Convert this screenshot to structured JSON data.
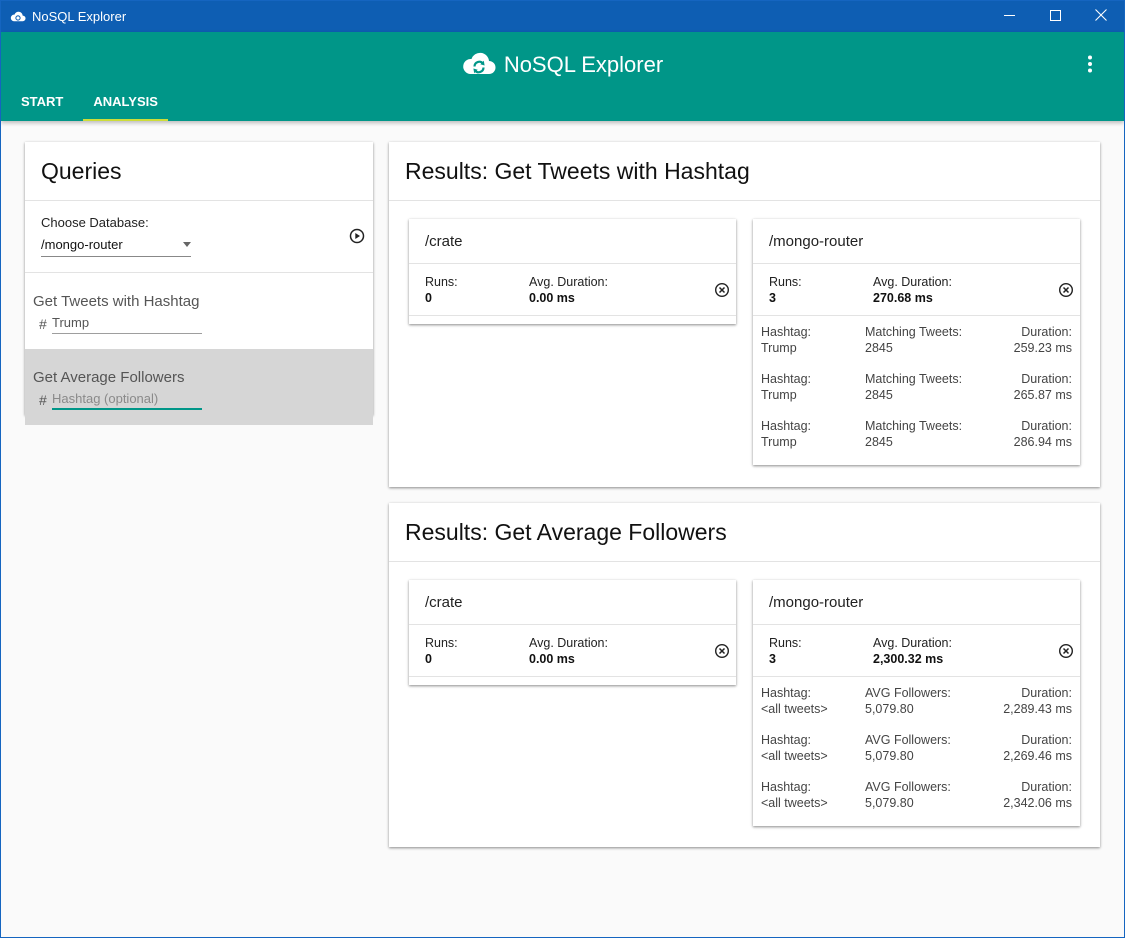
{
  "window": {
    "title": "NoSQL Explorer",
    "controls": [
      "minimize-icon",
      "maximize-icon",
      "close-icon"
    ]
  },
  "header": {
    "app_name": "NoSQL Explorer",
    "logo_icon": "cloud-sync-icon",
    "menu_icon": "more-vertical-icon",
    "accent_color": "#009688",
    "tabs": [
      {
        "label": "START",
        "active": false
      },
      {
        "label": "ANALYSIS",
        "active": true
      }
    ]
  },
  "queries": {
    "title": "Queries",
    "db_label": "Choose Database:",
    "db_value": "/mongo-router",
    "run_icon": "play-circle-icon",
    "items": [
      {
        "title": "Get Tweets with Hashtag",
        "prefix": "#",
        "value": "Trump",
        "placeholder": "",
        "selected": false
      },
      {
        "title": "Get Average Followers",
        "prefix": "#",
        "value": "",
        "placeholder": "Hashtag (optional)",
        "selected": true
      }
    ]
  },
  "results": [
    {
      "title": "Results: Get Tweets with Hashtag",
      "databases": [
        {
          "name": "/crate",
          "runs_label": "Runs:",
          "runs": "0",
          "avg_label": "Avg. Duration:",
          "avg": "0.00 ms",
          "rows": []
        },
        {
          "name": "/mongo-router",
          "runs_label": "Runs:",
          "runs": "3",
          "avg_label": "Avg. Duration:",
          "avg": "270.68 ms",
          "rows": [
            {
              "c1_label": "Hashtag:",
              "c1_value": "Trump",
              "c2_label": "Matching Tweets:",
              "c2_value": "2845",
              "c3_label": "Duration:",
              "c3_value": "259.23 ms"
            },
            {
              "c1_label": "Hashtag:",
              "c1_value": "Trump",
              "c2_label": "Matching Tweets:",
              "c2_value": "2845",
              "c3_label": "Duration:",
              "c3_value": "265.87 ms"
            },
            {
              "c1_label": "Hashtag:",
              "c1_value": "Trump",
              "c2_label": "Matching Tweets:",
              "c2_value": "2845",
              "c3_label": "Duration:",
              "c3_value": "286.94 ms"
            }
          ]
        }
      ]
    },
    {
      "title": "Results: Get Average Followers",
      "databases": [
        {
          "name": "/crate",
          "runs_label": "Runs:",
          "runs": "0",
          "avg_label": "Avg. Duration:",
          "avg": "0.00 ms",
          "rows": []
        },
        {
          "name": "/mongo-router",
          "runs_label": "Runs:",
          "runs": "3",
          "avg_label": "Avg. Duration:",
          "avg": "2,300.32 ms",
          "rows": [
            {
              "c1_label": "Hashtag:",
              "c1_value": "<all tweets>",
              "c2_label": "AVG Followers:",
              "c2_value": "5,079.80",
              "c3_label": "Duration:",
              "c3_value": "2,289.43 ms"
            },
            {
              "c1_label": "Hashtag:",
              "c1_value": "<all tweets>",
              "c2_label": "AVG Followers:",
              "c2_value": "5,079.80",
              "c3_label": "Duration:",
              "c3_value": "2,269.46 ms"
            },
            {
              "c1_label": "Hashtag:",
              "c1_value": "<all tweets>",
              "c2_label": "AVG Followers:",
              "c2_value": "5,079.80",
              "c3_label": "Duration:",
              "c3_value": "2,342.06 ms"
            }
          ]
        }
      ]
    }
  ]
}
